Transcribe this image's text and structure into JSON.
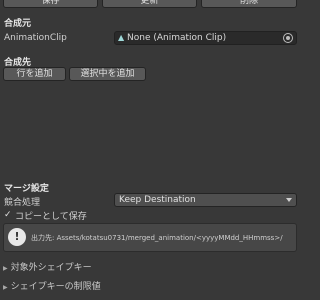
{
  "toolbar": {
    "save_label": "保存",
    "update_label": "更新",
    "delete_label": "削除"
  },
  "source": {
    "title": "合成元",
    "clip_label": "AnimationClip",
    "clip_value": "None (Animation Clip)",
    "clip_icon": "animation-clip-icon",
    "picker_icon": "object-picker-icon"
  },
  "target": {
    "title": "合成先",
    "add_row_label": "行を追加",
    "add_selected_label": "選択中を追加"
  },
  "merge": {
    "title": "マージ設定",
    "conflict_label": "競合処理",
    "conflict_value": "Keep Destination",
    "copy_label": "コピーとして保存",
    "copy_checked": true,
    "info_text": "出力先: Assets/kotatsu0731/merged_animation/<yyyyMMdd_HHmmss>/"
  },
  "foldouts": {
    "excluded_label": "対象外シェイプキー",
    "limits_label": "シェイプキーの制限値"
  },
  "colors": {
    "background": "#383838",
    "button": "#585858",
    "field": "#2a2a2a"
  }
}
